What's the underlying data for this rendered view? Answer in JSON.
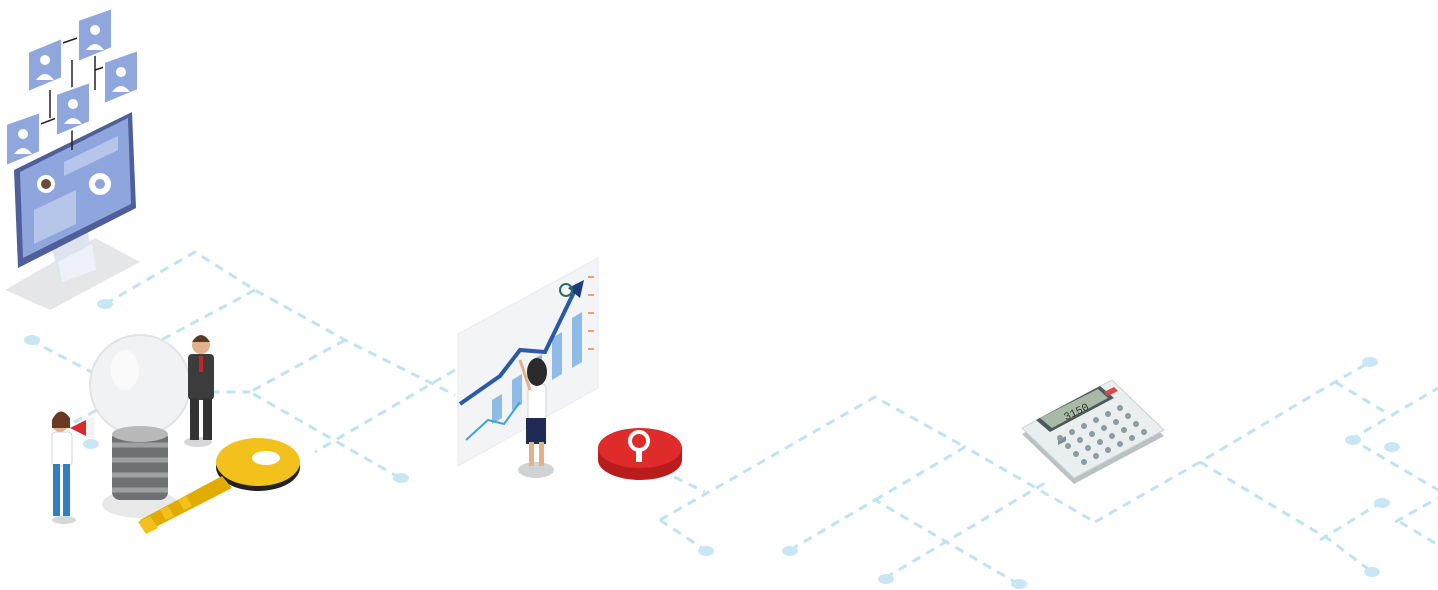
{
  "scene": {
    "calculator": {
      "display": "3150"
    }
  },
  "colors": {
    "background": "#ffffff",
    "dashed_lines": "#bfe3f3",
    "nodes": "#c9e6f5",
    "profile_blue": "#8fa7dc",
    "monitor_dark": "#4f5f99",
    "monitor_screen": "#8ea6dd",
    "key_yellow": "#f2c11b",
    "pin_red": "#e02b2b",
    "chart_blue": "#2a5aa7",
    "calculator_body": "#e9eeee"
  },
  "icons": {
    "org_chart_monitor": "org-chart-monitor-icon",
    "light_bulb": "light-bulb-icon",
    "key": "key-icon",
    "growth_chart": "growth-chart-icon",
    "location_pin": "location-pin-icon",
    "calculator": "calculator-icon"
  }
}
